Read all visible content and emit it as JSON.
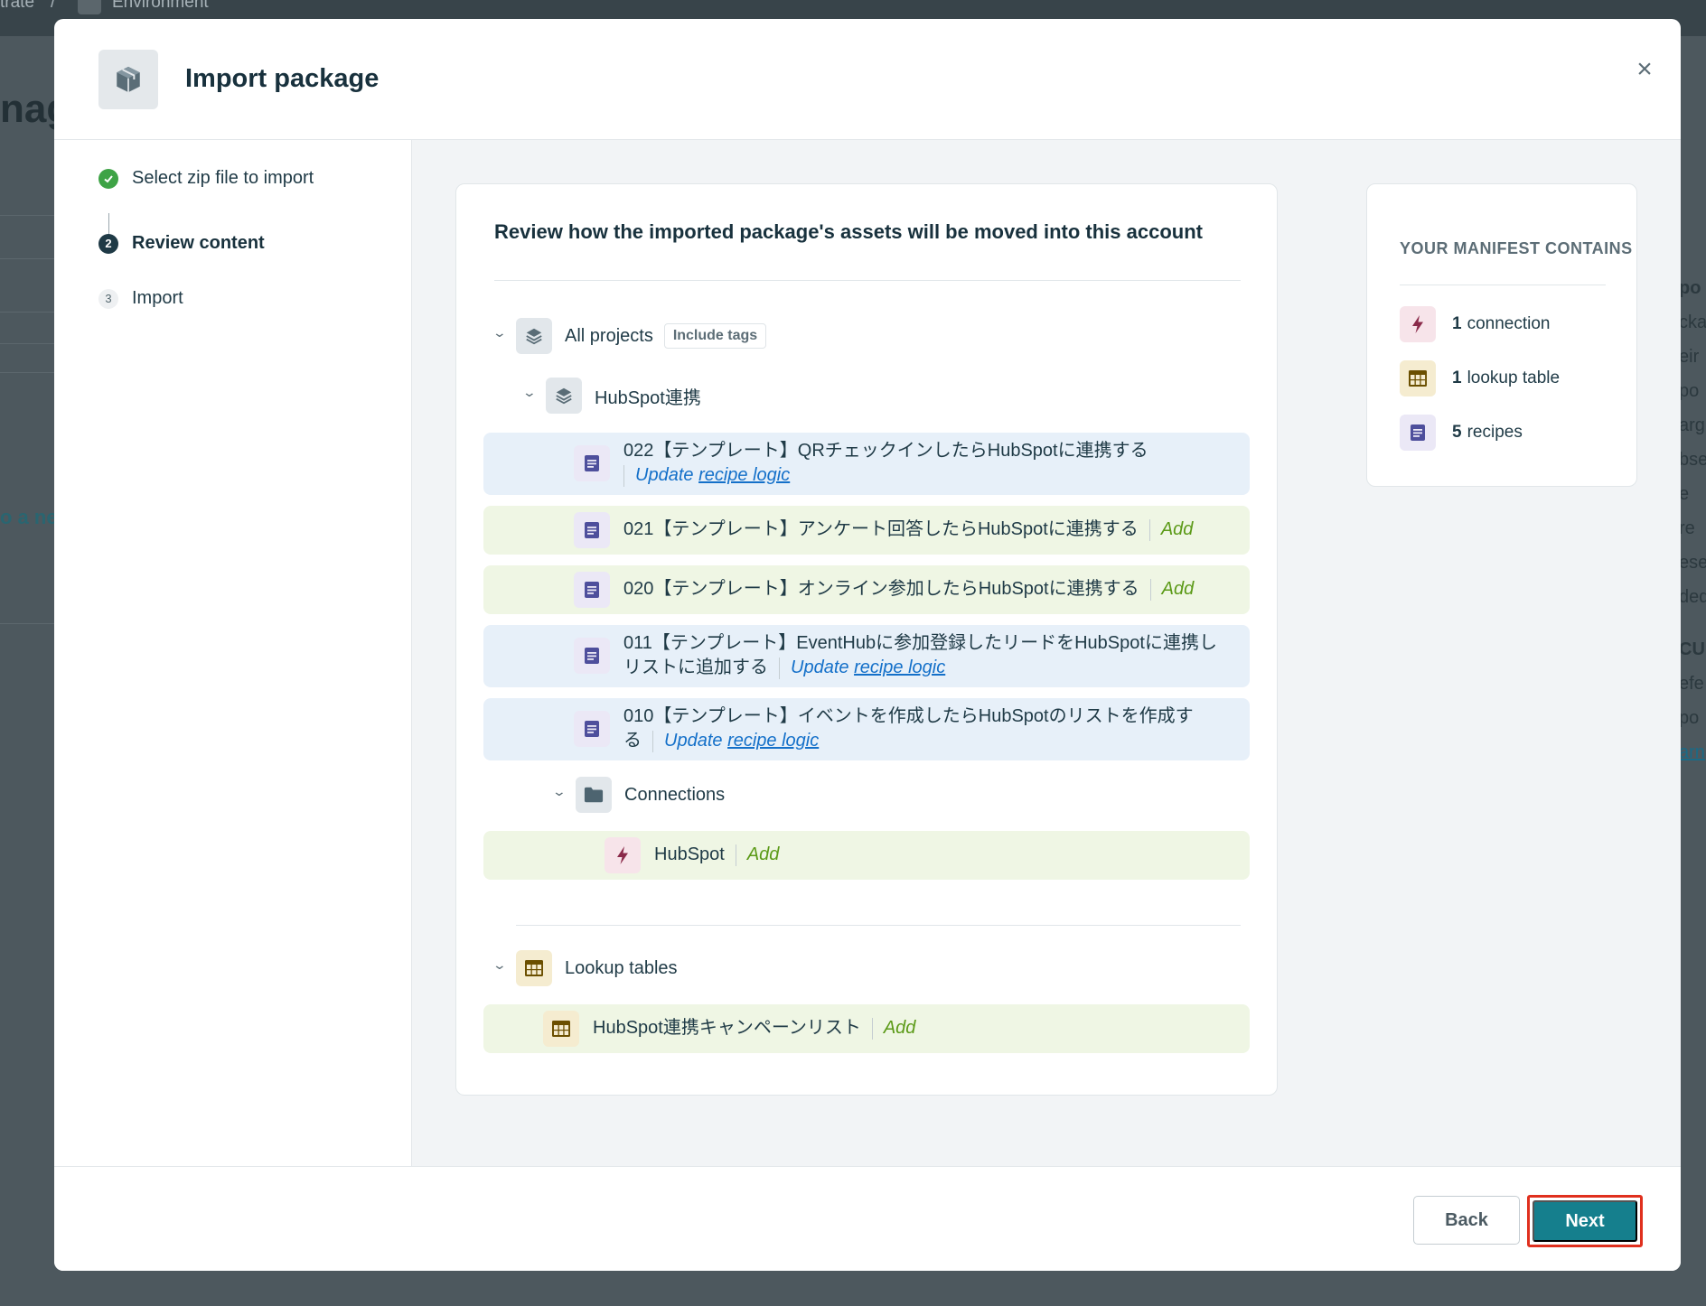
{
  "background": {
    "breadcrumb": [
      "trate",
      "/",
      "Environment"
    ],
    "page_title": "nage",
    "left_text": "o a nev",
    "right_fragments": [
      "po",
      "cka",
      "eir",
      "po",
      "arg",
      "bse",
      "e re",
      "ese",
      "ded",
      "CU",
      "efe",
      "po",
      "arn"
    ]
  },
  "modal": {
    "title": "Import package",
    "close_label": "×"
  },
  "steps": [
    {
      "number": "",
      "label": "Select zip file to import",
      "state": "done"
    },
    {
      "number": "2",
      "label": "Review content",
      "state": "active"
    },
    {
      "number": "3",
      "label": "Import",
      "state": "pending"
    }
  ],
  "review": {
    "title": "Review how the imported package's assets will be moved into this account",
    "all_projects_label": "All projects",
    "include_tags_label": "Include tags",
    "project_name": "HubSpot連携",
    "recipes": [
      {
        "name": "022【テンプレート】QRチェックインしたらHubSpotに連携する",
        "action_prefix": "Update ",
        "action_link": "recipe logic",
        "status": "update"
      },
      {
        "name": "021【テンプレート】アンケート回答したらHubSpotに連携する",
        "action": "Add",
        "status": "add"
      },
      {
        "name": "020【テンプレート】オンライン参加したらHubSpotに連携する",
        "action": "Add",
        "status": "add"
      },
      {
        "name_line1": "011【テンプレート】EventHubに参加登録したリードをHubSpotに連携し",
        "name_line2": "リストに追加する",
        "action_prefix": "Update ",
        "action_link": "recipe logic",
        "status": "update"
      },
      {
        "name_line1": "010【テンプレート】イベントを作成したらHubSpotのリストを作成す",
        "name_line2": "る",
        "action_prefix": "Update ",
        "action_link": "recipe logic",
        "status": "update"
      }
    ],
    "connections_folder": "Connections",
    "connection": {
      "name": "HubSpot",
      "action": "Add"
    },
    "lookup_tables_label": "Lookup tables",
    "lookup_table": {
      "name": "HubSpot連携キャンペーンリスト",
      "action": "Add"
    }
  },
  "manifest": {
    "title": "YOUR MANIFEST CONTAINS",
    "items": [
      {
        "count": "1",
        "label": "connection",
        "icon": "bolt-icon"
      },
      {
        "count": "1",
        "label": "lookup table",
        "icon": "table-icon"
      },
      {
        "count": "5",
        "label": "recipes",
        "icon": "recipe-icon"
      }
    ]
  },
  "footer": {
    "back_label": "Back",
    "next_label": "Next"
  },
  "colors": {
    "update_row": "#e7f0f9",
    "add_row": "#eff6e4",
    "add_text": "#5b9a17",
    "update_text": "#1470c9",
    "primary_button": "#157f8d",
    "highlight_outline": "#e0301e",
    "step_done": "#3ea346"
  }
}
